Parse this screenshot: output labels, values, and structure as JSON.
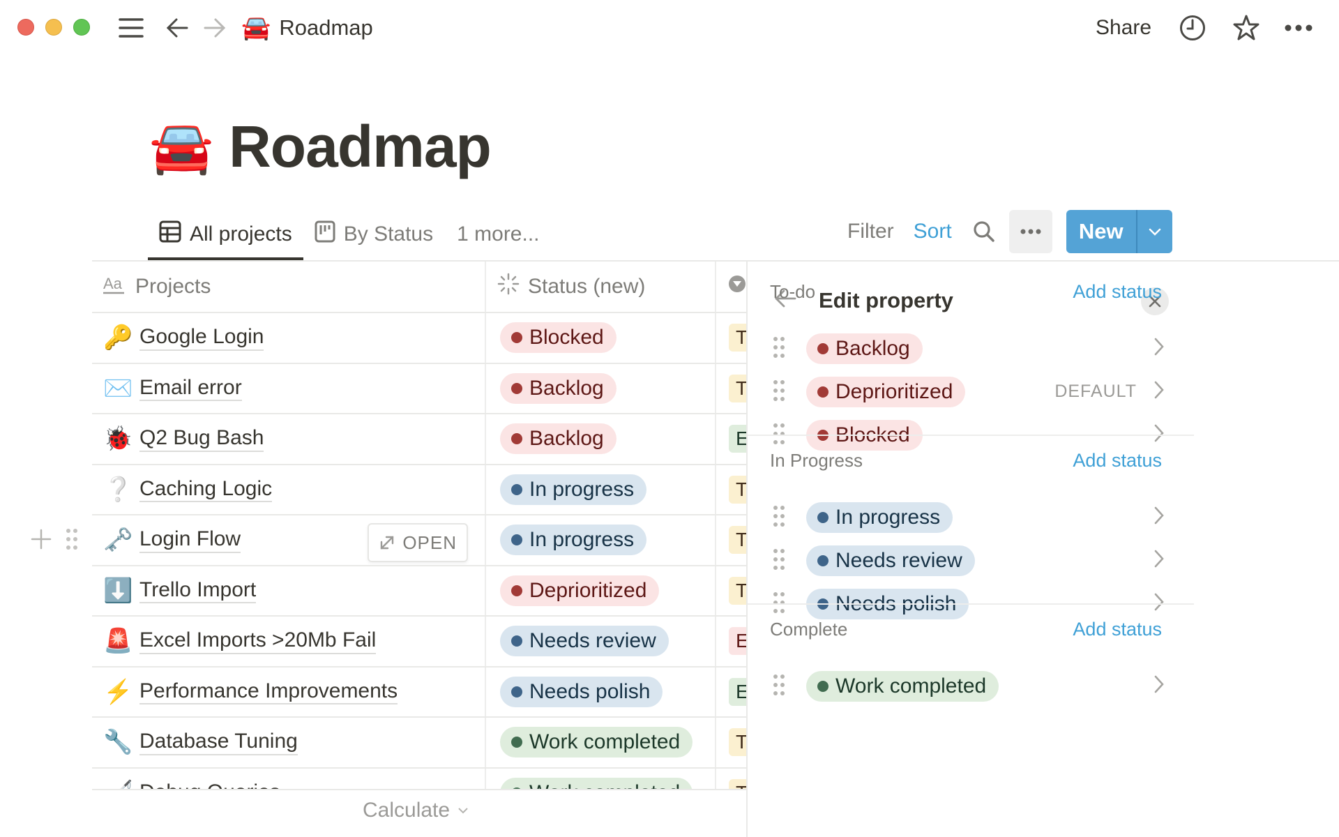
{
  "window": {
    "breadcrumb": {
      "emoji": "🚘",
      "label": "Roadmap"
    },
    "share_label": "Share",
    "icons": [
      "menu-icon",
      "back-arrow-icon",
      "forward-arrow-icon",
      "history-clock-icon",
      "favorite-star-icon",
      "more-options-icon"
    ]
  },
  "page": {
    "emoji": "🚘",
    "title": "Roadmap"
  },
  "views": {
    "tabs": [
      {
        "label": "All projects",
        "icon": "table-icon",
        "active": true
      },
      {
        "label": "By Status",
        "icon": "board-icon",
        "active": false
      }
    ],
    "more_label": "1 more..."
  },
  "toolbar": {
    "filter_label": "Filter",
    "sort_label": "Sort",
    "new_label": "New"
  },
  "table": {
    "columns": [
      {
        "label": "Projects",
        "icon": "text-property-icon"
      },
      {
        "label": "Status (new)",
        "icon": "status-property-icon"
      },
      {
        "label": "",
        "icon": "select-property-icon"
      }
    ],
    "rows": [
      {
        "emoji": "🔑",
        "title": "Google Login",
        "status": "Blocked",
        "status_color": "red",
        "tag": "T",
        "tag_color": "yellow"
      },
      {
        "emoji": "✉️",
        "title": "Email error",
        "status": "Backlog",
        "status_color": "red",
        "tag": "T",
        "tag_color": "yellow"
      },
      {
        "emoji": "🐞",
        "title": "Q2 Bug Bash",
        "status": "Backlog",
        "status_color": "red",
        "tag": "E",
        "tag_color": "green"
      },
      {
        "emoji": "❔",
        "title": "Caching Logic",
        "status": "In progress",
        "status_color": "blue",
        "tag": "T",
        "tag_color": "yellow"
      },
      {
        "emoji": "🗝️",
        "title": "Login Flow",
        "status": "In progress",
        "status_color": "blue",
        "tag": "T",
        "tag_color": "yellow",
        "hovered": true
      },
      {
        "emoji": "⬇️",
        "title": "Trello Import",
        "status": "Deprioritized",
        "status_color": "red",
        "tag": "T",
        "tag_color": "yellow"
      },
      {
        "emoji": "🚨",
        "title": "Excel Imports >20Mb Fail",
        "status": "Needs review",
        "status_color": "blue",
        "tag": "E",
        "tag_color": "red"
      },
      {
        "emoji": "⚡",
        "title": "Performance Improvements",
        "status": "Needs polish",
        "status_color": "blue",
        "tag": "E",
        "tag_color": "green"
      },
      {
        "emoji": "🔧",
        "title": "Database Tuning",
        "status": "Work completed",
        "status_color": "green",
        "tag": "T",
        "tag_color": "yellow"
      },
      {
        "emoji": "🦯",
        "title": "Debug Queries",
        "status": "Work completed",
        "status_color": "green",
        "tag": "T",
        "tag_color": "yellow"
      }
    ],
    "open_label": "OPEN",
    "calculate_label": "Calculate"
  },
  "edit_property": {
    "title": "Edit property",
    "default_label": "DEFAULT",
    "groups": [
      {
        "label": "To-do",
        "add_label": "Add status",
        "options": [
          {
            "label": "Backlog",
            "color": "red",
            "default": false
          },
          {
            "label": "Deprioritized",
            "color": "red",
            "default": true
          },
          {
            "label": "Blocked",
            "color": "red",
            "default": false
          }
        ]
      },
      {
        "label": "In Progress",
        "add_label": "Add status",
        "options": [
          {
            "label": "In progress",
            "color": "blue",
            "default": false
          },
          {
            "label": "Needs review",
            "color": "blue",
            "default": false
          },
          {
            "label": "Needs polish",
            "color": "blue",
            "default": false
          }
        ]
      },
      {
        "label": "Complete",
        "add_label": "Add status",
        "options": [
          {
            "label": "Work completed",
            "color": "green",
            "default": false
          }
        ]
      }
    ]
  },
  "colors": {
    "accent_blue": "#54a3d6",
    "link_blue": "#3fa0d6",
    "red_pill_bg": "#fbe4e4",
    "blue_pill_bg": "#d9e5ef",
    "green_pill_bg": "#dfeddd"
  }
}
